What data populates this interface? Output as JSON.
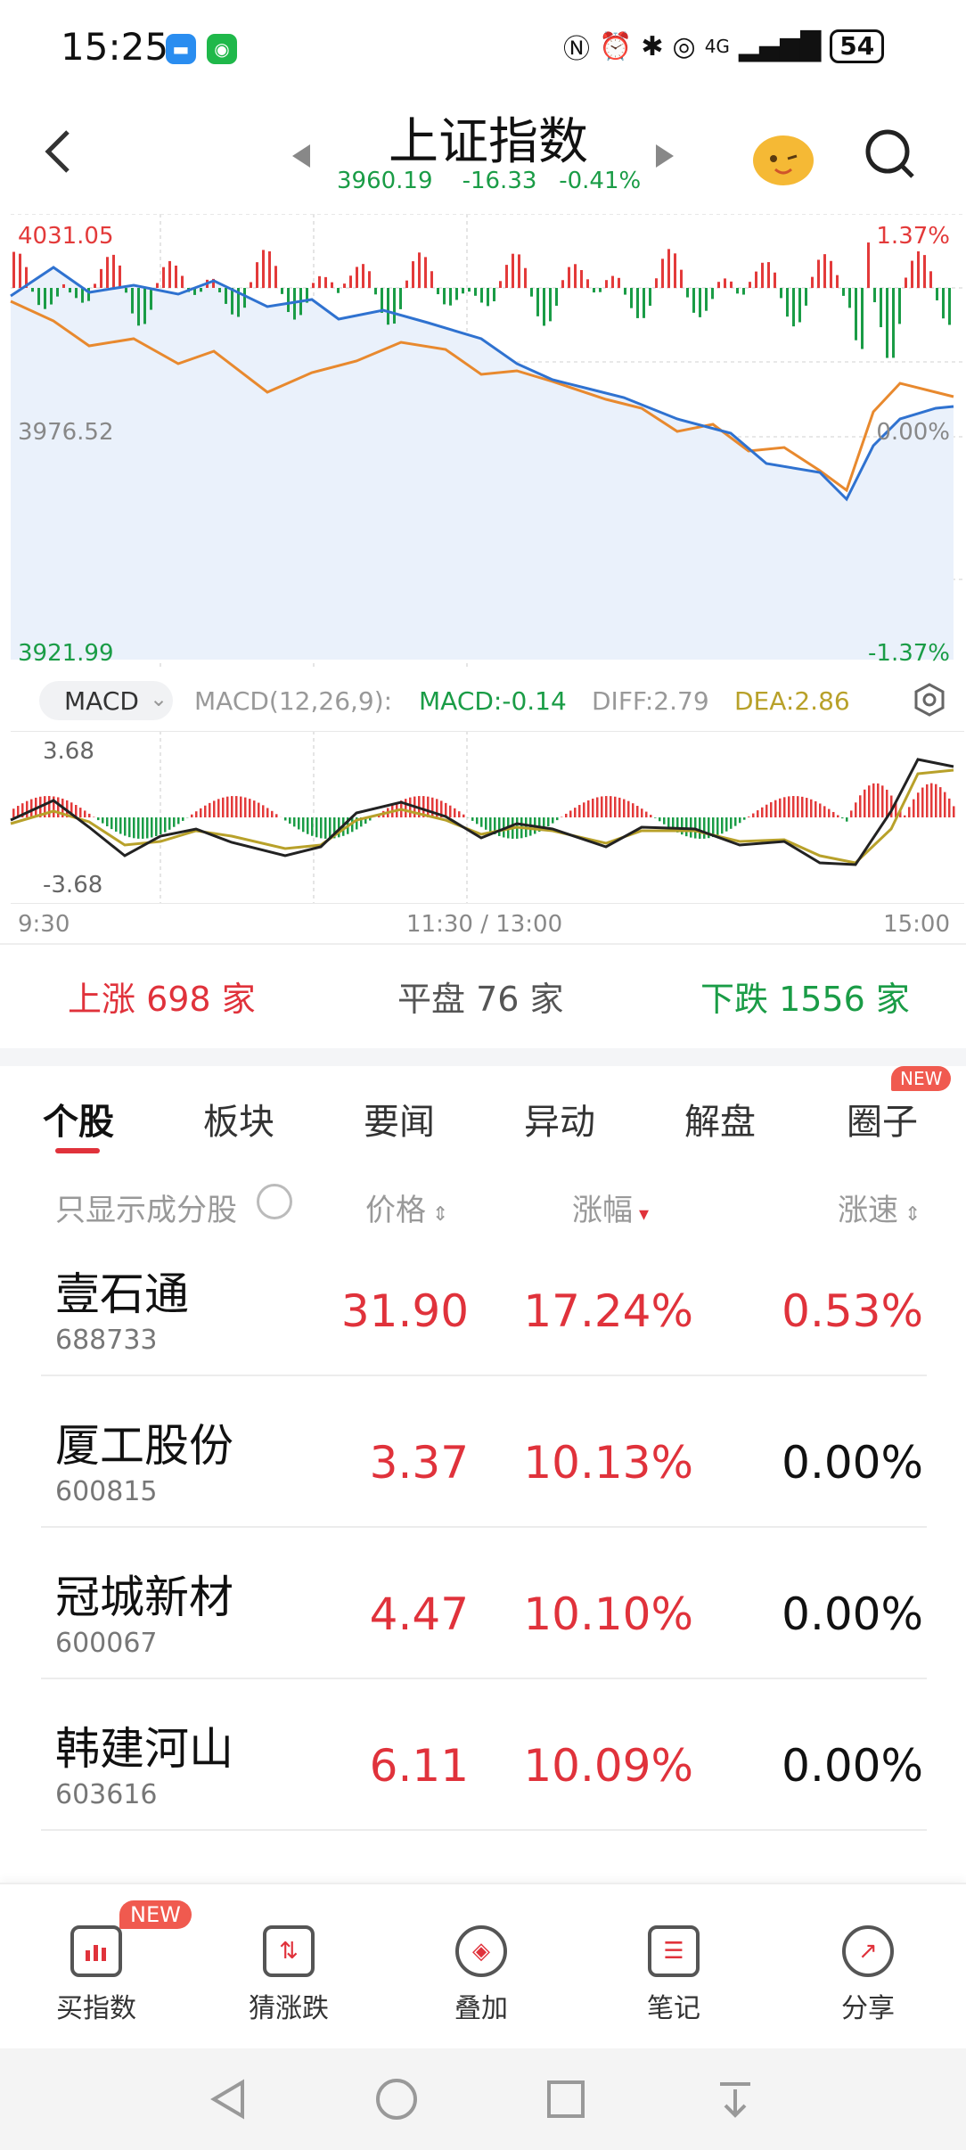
{
  "status": {
    "time": "15:25",
    "battery": "54",
    "signal": "4G"
  },
  "header": {
    "title": "上证指数",
    "price": "3960.19",
    "change": "-16.33",
    "change_pct": "-0.41%"
  },
  "chart": {
    "top_left": "4031.05",
    "top_right": "1.37%",
    "mid_left": "3976.52",
    "mid_right": "0.00%",
    "bottom_left": "3921.99",
    "bottom_right": "-1.37%",
    "colors": {
      "up": "#e33a3a",
      "down": "#1a9c46",
      "price_line": "#2f72d0",
      "avg_line": "#e8892e"
    }
  },
  "macd": {
    "selector": "MACD",
    "params": "MACD(12,26,9):",
    "macd": "MACD:-0.14",
    "diff": "DIFF:2.79",
    "dea": "DEA:2.86",
    "top": "3.68",
    "bottom": "-3.68"
  },
  "time_axis": {
    "start": "9:30",
    "mid": "11:30 / 13:00",
    "end": "15:00"
  },
  "breadth": {
    "up": "上涨 698 家",
    "flat": "平盘 76 家",
    "down": "下跌 1556 家"
  },
  "tabs": [
    "个股",
    "板块",
    "要闻",
    "异动",
    "解盘",
    "圈子"
  ],
  "tab_badge": "NEW",
  "table": {
    "filter_label": "只显示成分股",
    "col_price": "价格",
    "col_change": "涨幅",
    "col_speed": "涨速",
    "rows": [
      {
        "name": "壹石通",
        "code": "688733",
        "price": "31.90",
        "change": "17.24%",
        "speed": "0.53%"
      },
      {
        "name": "厦工股份",
        "code": "600815",
        "price": "3.37",
        "change": "10.13%",
        "speed": "0.00%"
      },
      {
        "name": "冠城新材",
        "code": "600067",
        "price": "4.47",
        "change": "10.10%",
        "speed": "0.00%"
      },
      {
        "name": "韩建河山",
        "code": "603616",
        "price": "6.11",
        "change": "10.09%",
        "speed": "0.00%"
      }
    ]
  },
  "bottom_nav": {
    "items": [
      {
        "label": "买指数",
        "icon": "bar-chart-icon"
      },
      {
        "label": "猜涨跌",
        "icon": "updown-icon"
      },
      {
        "label": "叠加",
        "icon": "layers-icon"
      },
      {
        "label": "笔记",
        "icon": "note-icon"
      },
      {
        "label": "分享",
        "icon": "share-icon"
      }
    ],
    "badge": "NEW"
  }
}
